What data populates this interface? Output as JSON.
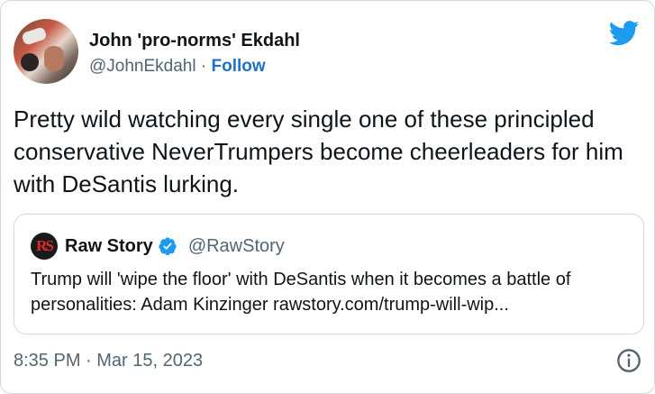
{
  "colors": {
    "accent": "#1d9bf0",
    "follow": "#1d72c8",
    "text": "#0f1419",
    "muted": "#536471",
    "border": "#cfd9de",
    "rawstory_red": "#e02a2a"
  },
  "author": {
    "display_name": "John 'pro-norms' Ekdahl",
    "handle": "@JohnEkdahl",
    "separator": " · ",
    "follow_label": "Follow",
    "avatar_icon": "profile-photo"
  },
  "brand_icon": "twitter-bird-icon",
  "tweet": {
    "text": "Pretty wild watching every single one of these principled conservative NeverTrumpers become cheerleaders for him with DeSantis lurking."
  },
  "quote": {
    "logo_text": "RS",
    "name": "Raw Story",
    "verified_icon": "verified-badge-icon",
    "handle": "@RawStory",
    "text": "Trump will 'wipe the floor' with DeSantis when it becomes a battle of personalities: Adam Kinzinger rawstory.com/trump-will-wip..."
  },
  "footer": {
    "timestamp": "8:35 PM · Mar 15, 2023",
    "info_icon": "info-icon"
  }
}
